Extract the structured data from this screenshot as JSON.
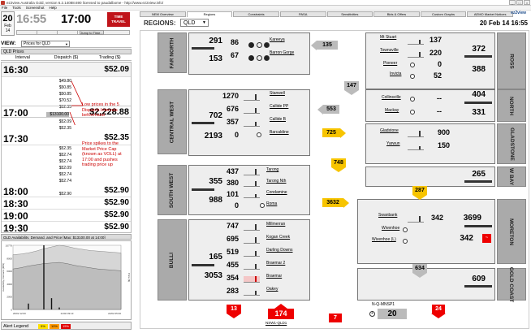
{
  "window": {
    "title": "ez2view Australia Gold, version 6.2.14088.690 licensed to paudalbome - http://www.ez2view.info/",
    "menu": [
      "File",
      "Tools",
      "Screenshot",
      "Help"
    ]
  },
  "header": {
    "date_day": "20",
    "date_month": "Feb 14",
    "clock_current": "16:55",
    "clock_displayed": "17:00",
    "time_travel": "TIME TRAVEL",
    "jump_label": "Jump to Time..."
  },
  "view": {
    "label": "VIEW:",
    "selected": "Prices for QLD"
  },
  "prices": {
    "section": "QLD Prices",
    "col_interval": "Interval",
    "col_dispatch": "Dispatch ($)",
    "col_trading": "Trading ($)",
    "rows": [
      {
        "interval": "16:30",
        "dispatch": "",
        "trading": "$52.09"
      },
      {
        "interval": "17:00",
        "dispatch": "$2,228.88",
        "trading": "$2,228.88"
      },
      {
        "interval": "17:30",
        "dispatch": "",
        "trading": "$52.35"
      },
      {
        "interval": "18:00",
        "dispatch": "",
        "trading": "$52.90"
      },
      {
        "interval": "18:30",
        "dispatch": "",
        "trading": "$52.90"
      },
      {
        "interval": "19:00",
        "dispatch": "",
        "trading": "$52.90"
      },
      {
        "interval": "19:30",
        "dispatch": "",
        "trading": "$52.90"
      }
    ],
    "sub_1700": [
      "$49.80",
      "$50.85",
      "$50.85",
      "$70.52",
      "$52.35",
      "$13100.00"
    ],
    "sub_1730": [
      "$52.09",
      "$52.35",
      "$52.35",
      "$52.74",
      "$52.74",
      "$52.09",
      "$52.74",
      "$52.74"
    ],
    "sub_1800": [
      "$52.90"
    ],
    "annotation_1": "Low prices in the 5 Dispatch Intervals beforehand",
    "annotation_2": "Price spikes to the Market Price Cap (known as VOLL) at 17:00 and pushes trading price up"
  },
  "chart_data": {
    "type": "area",
    "title": "QLD Availability, Demand, and Price [Max: $13100.00 at 14:00]",
    "ylabel": "Availability, Demand (MW)",
    "y2label": "Price ($)",
    "x_ticks": [
      "20/02 12:00",
      "21/02 09:13",
      "22/02 05:00"
    ],
    "y_ticks": [
      "10779",
      "8000",
      "6000",
      "4000",
      "2000",
      "0"
    ],
    "series": [
      {
        "name": "Availability",
        "values": [
          9200,
          9300,
          9500,
          9800,
          10200,
          10500,
          10779,
          10600,
          10300,
          10100,
          9900,
          9800,
          9700,
          9600,
          9500
        ]
      },
      {
        "name": "Demand",
        "values": [
          6800,
          7000,
          7300,
          7500,
          7700,
          7800,
          7900,
          7700,
          7400,
          7200,
          7000,
          6800,
          6700,
          6600,
          6500
        ]
      },
      {
        "name": "Price",
        "values": [
          0,
          0,
          1200,
          0,
          13100,
          2300,
          400,
          0,
          0,
          0,
          0,
          0,
          0,
          0,
          0
        ]
      }
    ]
  },
  "alerts": {
    "label": "Alert Legend",
    "items": [
      {
        "text": "5%",
        "color": "#ffe000"
      },
      {
        "text": "10%",
        "color": "#ff9900"
      },
      {
        "text": "15%",
        "color": "#e00000"
      }
    ]
  },
  "tabs": [
    "NEM Overview",
    "Regions",
    "Constraints",
    "PASA",
    "Sensitivities",
    "Bids & Offers",
    "Custom Graphs",
    "AEMO Market Notices"
  ],
  "brand": "ez2view",
  "region": {
    "label": "REGIONS:",
    "selected": "QLD",
    "date": "20 Feb 14 16:55"
  },
  "zones": {
    "far_north": {
      "label": "FAR NORTH",
      "val1": "291",
      "val2": "153"
    },
    "central_west": {
      "label": "CENTRAL WEST",
      "val1": "702",
      "val2": "2193"
    },
    "south_west": {
      "label": "SOUTH WEST",
      "val1": "355",
      "val2": "988"
    },
    "bulli": {
      "label": "BULLI",
      "val1": "165",
      "val2": "3053"
    },
    "ross": {
      "label": "ROSS",
      "val1": "372",
      "val2": "388"
    },
    "north": {
      "label": "NORTH",
      "val1": "404",
      "val2": "331"
    },
    "gladstone": {
      "label": "GLADSTONE",
      "val1": "",
      "val2": ""
    },
    "wide_bay": {
      "label": "W BAY",
      "val1": "265",
      "val2": ""
    },
    "moreton": {
      "label": "MORETON",
      "val1": "3699",
      "val2": "342"
    },
    "gold_coast": {
      "label": "GOLD COAST",
      "val1": "609",
      "val2": ""
    }
  },
  "stations": {
    "far_north": [
      {
        "name": "Kareeya",
        "mw": "86"
      },
      {
        "name": "Barron Gorge",
        "mw": "67"
      }
    ],
    "central_west": [
      {
        "name": "Stanwell",
        "mw": "1270"
      },
      {
        "name": "Callide PP",
        "mw": "676"
      },
      {
        "name": "Callide B",
        "mw": "357"
      },
      {
        "name": "Barcaldine",
        "mw": "0"
      }
    ],
    "south_west": [
      {
        "name": "Tarong",
        "mw": "437"
      },
      {
        "name": "Tarong Nth",
        "mw": "380"
      },
      {
        "name": "Condamine",
        "mw": "101"
      },
      {
        "name": "Roma",
        "mw": "0"
      }
    ],
    "bulli": [
      {
        "name": "Millmerran",
        "mw": "747"
      },
      {
        "name": "Kogan Creek",
        "mw": "695"
      },
      {
        "name": "Darling Downs",
        "mw": "519"
      },
      {
        "name": "Braemar 2",
        "mw": "455"
      },
      {
        "name": "Braemar",
        "mw": "354"
      },
      {
        "name": "Oakey",
        "mw": "283"
      }
    ],
    "ross": [
      {
        "name": "Mt Stuart",
        "mw": "137"
      },
      {
        "name": "Townsville",
        "mw": "220"
      },
      {
        "name": "Pioneer",
        "mw": "0"
      },
      {
        "name": "Invicta",
        "mw": "52"
      }
    ],
    "north": [
      {
        "name": "Collinsville",
        "mw": "--"
      },
      {
        "name": "Mackay",
        "mw": "--"
      }
    ],
    "gladstone": [
      {
        "name": "Gladstone",
        "mw": "900"
      },
      {
        "name": "Yarwun",
        "mw": "150"
      }
    ],
    "moreton": [
      {
        "name": "Swanbank",
        "mw": "342"
      },
      {
        "name": "Wivenhoe",
        "mw": "0"
      },
      {
        "name": "Wivenhoe (L)",
        "mw": "0"
      }
    ]
  },
  "flows": {
    "f135": "135",
    "f147": "147",
    "f553": "553",
    "f725": "725",
    "f748": "748",
    "f3632": "3632",
    "f287": "287",
    "f634": "634",
    "f13": "13",
    "f174": "174",
    "f7": "7",
    "f24": "24",
    "f20": "20"
  },
  "interconnectors": {
    "nsw": "NSW1-QLD1",
    "nq": "N-Q-MNSP1"
  }
}
